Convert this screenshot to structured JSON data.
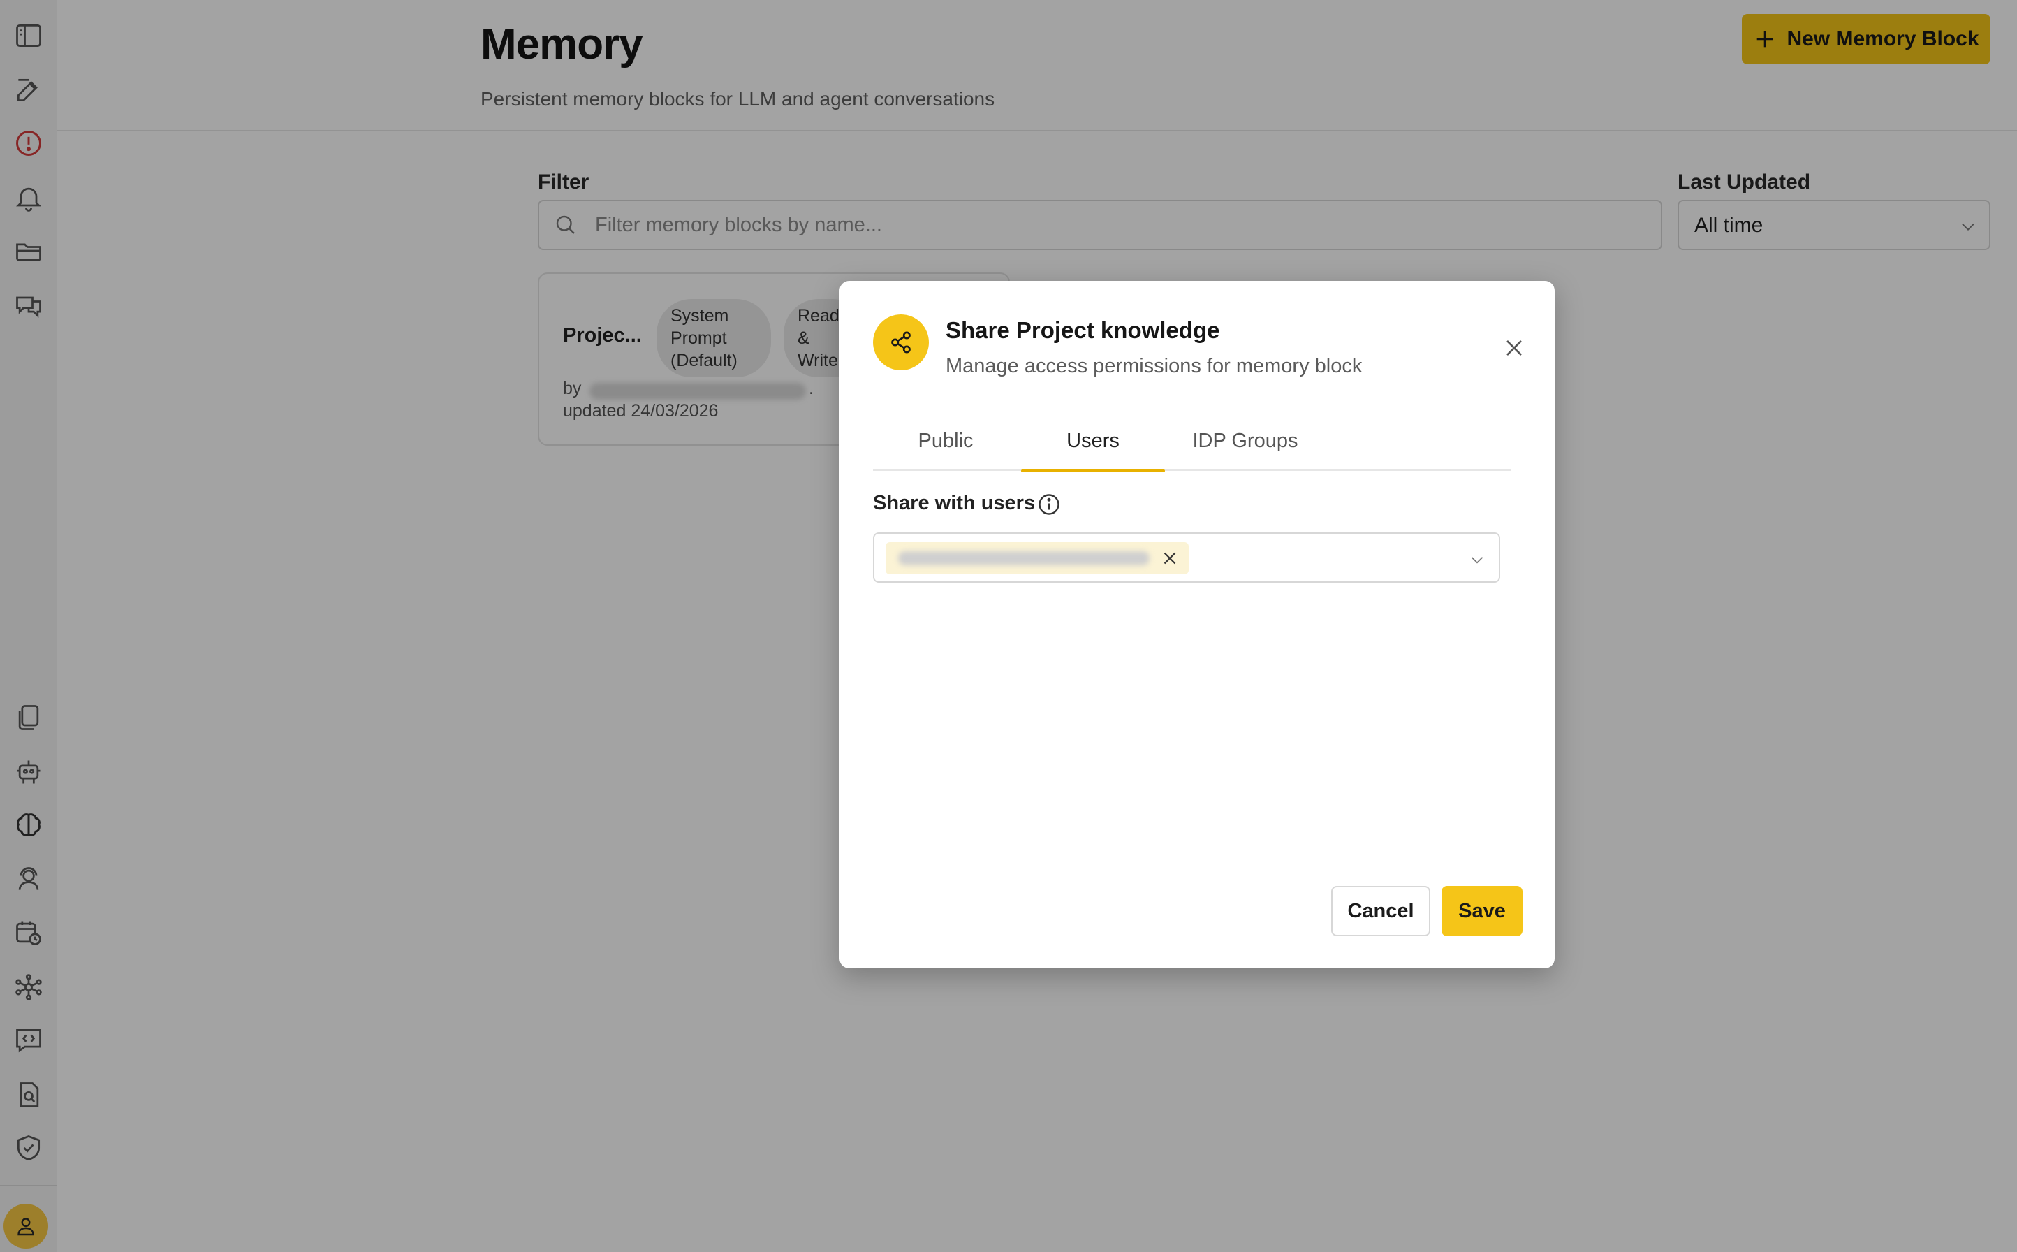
{
  "page": {
    "title": "Memory",
    "subtitle": "Persistent memory blocks for LLM and agent conversations",
    "new_button_label": "New Memory Block"
  },
  "filters": {
    "filter_label": "Filter",
    "search_placeholder": "Filter memory blocks by name...",
    "last_updated_label": "Last Updated",
    "last_updated_value": "All time"
  },
  "card": {
    "title": "Projec...",
    "chip_type": "System Prompt (Default)",
    "chip_access": "Read & Write",
    "by_label": "by",
    "by_suffix": ".",
    "updated": "updated 24/03/2026"
  },
  "modal": {
    "title": "Share Project knowledge",
    "subtitle": "Manage access permissions for memory block",
    "tabs": [
      {
        "label": "Public",
        "active": false
      },
      {
        "label": "Users",
        "active": true
      },
      {
        "label": "IDP Groups",
        "active": false
      }
    ],
    "share_label": "Share with users",
    "cancel_label": "Cancel",
    "save_label": "Save"
  },
  "sidebar": {
    "icons": [
      "panel-toggle-icon",
      "compose-icon",
      "alert-icon",
      "bell-icon",
      "folder-icon",
      "chat-icon",
      "documents-icon",
      "robot-icon",
      "brain-icon",
      "assistant-icon",
      "schedule-icon",
      "network-icon",
      "code-chat-icon",
      "file-search-icon",
      "shield-check-icon"
    ]
  },
  "colors": {
    "accent": "#f5c518",
    "tab_indicator": "#e8b100",
    "alert": "#d33a3a"
  }
}
